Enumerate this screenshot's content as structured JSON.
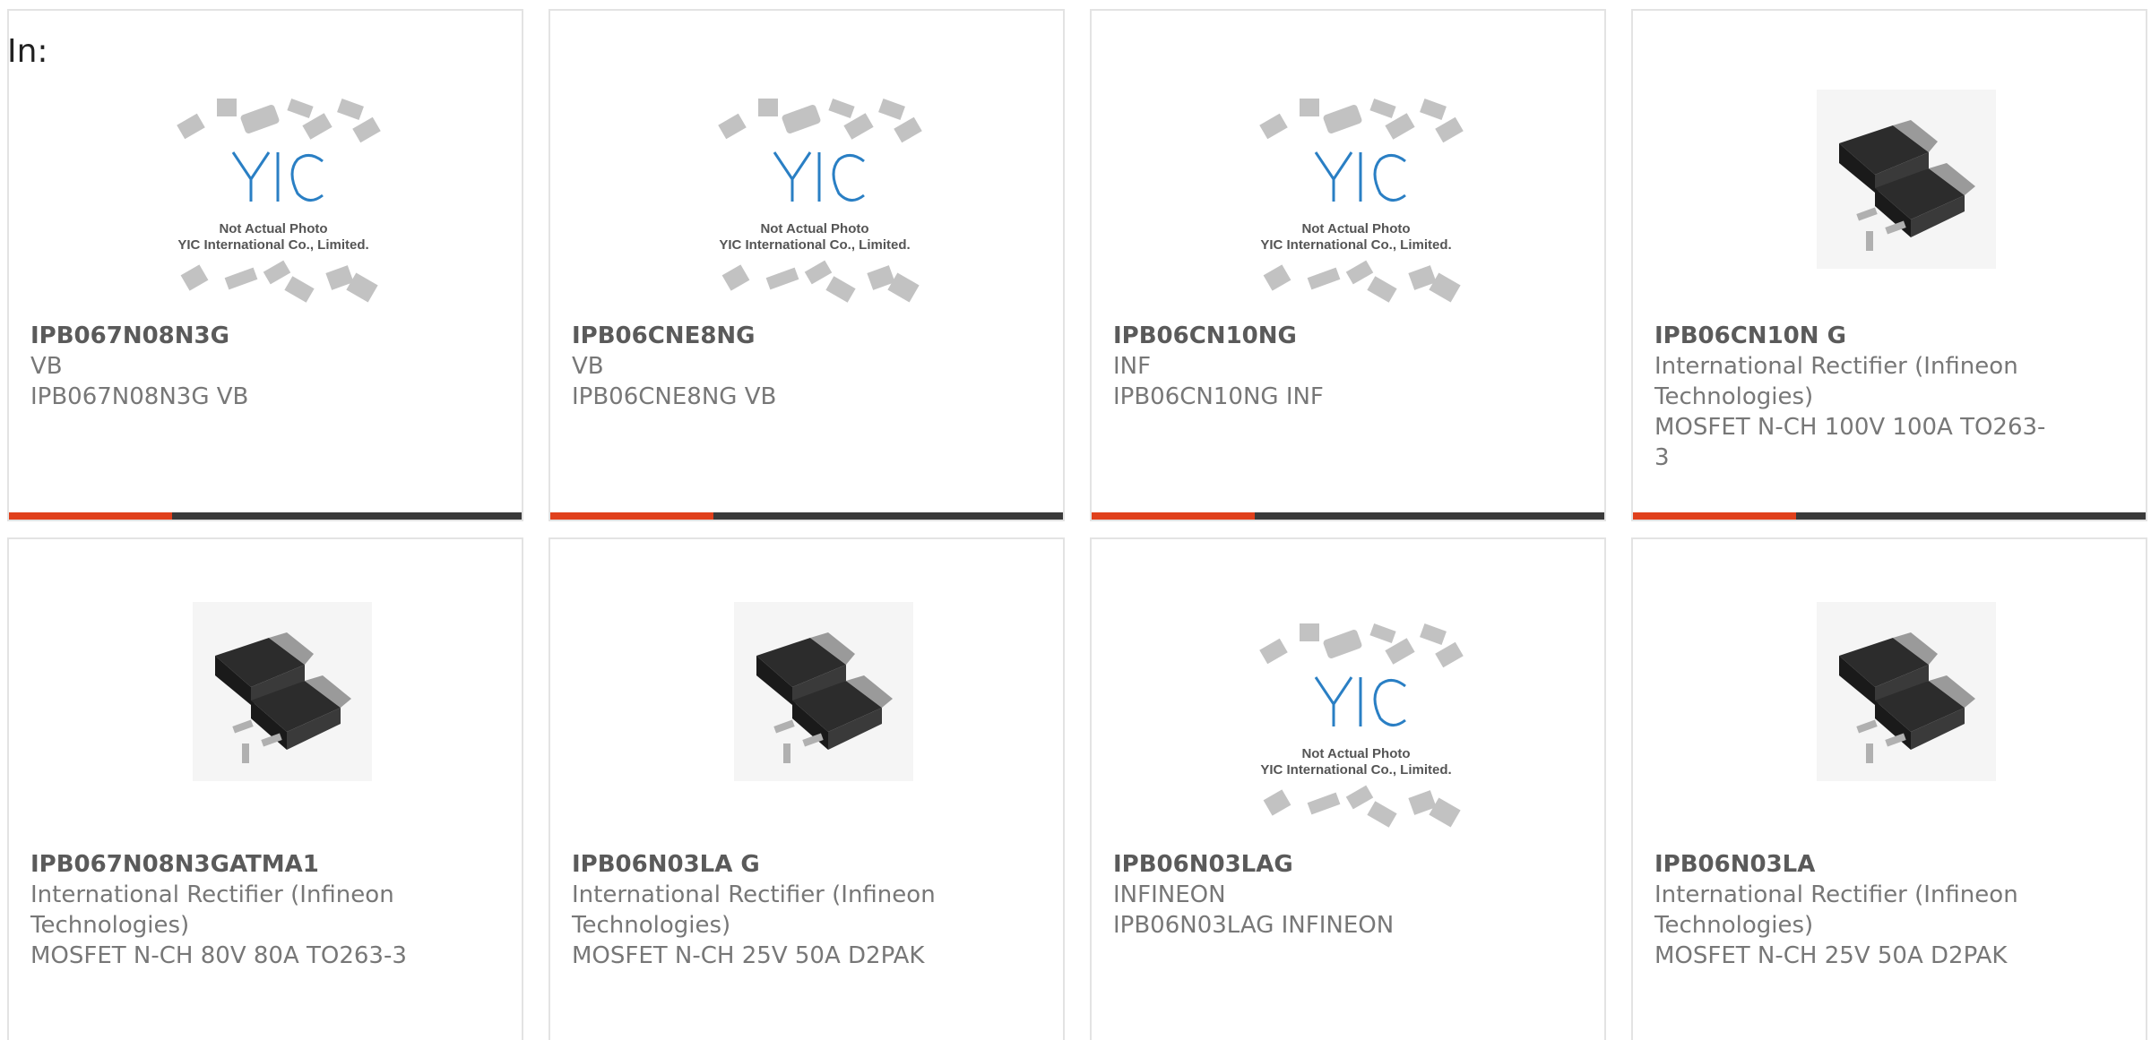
{
  "header": {
    "in_label": "In:"
  },
  "products": [
    {
      "part": "IPB067N08N3G",
      "manufacturer": "VB",
      "description": "IPB067N08N3G VB",
      "image": "placeholder-logo-icon"
    },
    {
      "part": "IPB06CNE8NG",
      "manufacturer": "VB",
      "description": "IPB06CNE8NG VB",
      "image": "placeholder-logo-icon"
    },
    {
      "part": "IPB06CN10NG",
      "manufacturer": "INF",
      "description": "IPB06CN10NG INF",
      "image": "placeholder-logo-icon"
    },
    {
      "part": "IPB06CN10N G",
      "manufacturer": "International Rectifier (Infineon Technologies)",
      "description": "MOSFET N-CH 100V 100A TO263-3",
      "image": "d2pak-package-icon"
    },
    {
      "part": "IPB067N08N3GATMA1",
      "manufacturer": "International Rectifier (Infineon Technologies)",
      "description": "MOSFET N-CH 80V 80A TO263-3",
      "image": "d2pak-package-icon"
    },
    {
      "part": "IPB06N03LA G",
      "manufacturer": "International Rectifier (Infineon Technologies)",
      "description": "MOSFET N-CH 25V 50A D2PAK",
      "image": "d2pak-package-icon"
    },
    {
      "part": "IPB06N03LAG",
      "manufacturer": "INFINEON",
      "description": "IPB06N03LAG INFINEON",
      "image": "placeholder-logo-icon"
    },
    {
      "part": "IPB06N03LA",
      "manufacturer": "International Rectifier (Infineon Technologies)",
      "description": "MOSFET N-CH 25V 50A D2PAK",
      "image": "d2pak-package-icon"
    }
  ],
  "placeholder": {
    "logo_text": "YIC",
    "line1": "Not Actual Photo",
    "line2": "YIC International Co., Limited."
  },
  "colors": {
    "accent": "#e0401c",
    "bar": "#3a3a3a",
    "logo": "#2a7fc4"
  }
}
